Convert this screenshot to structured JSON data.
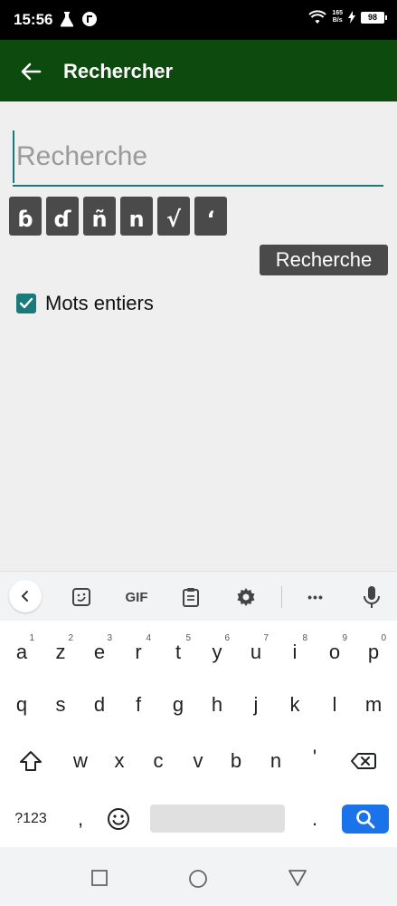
{
  "status": {
    "time": "15:56",
    "net_speed_value": "165",
    "net_speed_unit": "B/s",
    "battery": "98"
  },
  "app_bar": {
    "title": "Rechercher"
  },
  "search": {
    "placeholder": "Recherche",
    "value": ""
  },
  "special_chars": [
    "ɓ",
    "ɗ",
    "ñ",
    "n",
    "√",
    "ʻ"
  ],
  "search_button_label": "Recherche",
  "whole_words": {
    "label": "Mots entiers",
    "checked": true
  },
  "keyboard_toolbar": {
    "gif_label": "GIF",
    "more_label": "•••"
  },
  "keyboard": {
    "row1": [
      {
        "key": "a",
        "hint": "1"
      },
      {
        "key": "z",
        "hint": "2"
      },
      {
        "key": "e",
        "hint": "3"
      },
      {
        "key": "r",
        "hint": "4"
      },
      {
        "key": "t",
        "hint": "5"
      },
      {
        "key": "y",
        "hint": "6"
      },
      {
        "key": "u",
        "hint": "7"
      },
      {
        "key": "i",
        "hint": "8"
      },
      {
        "key": "o",
        "hint": "9"
      },
      {
        "key": "p",
        "hint": "0"
      }
    ],
    "row2": [
      "q",
      "s",
      "d",
      "f",
      "g",
      "h",
      "j",
      "k",
      "l",
      "m"
    ],
    "row3": [
      "w",
      "x",
      "c",
      "v",
      "b",
      "n",
      "'"
    ],
    "symbols_label": "?123",
    "comma": ",",
    "period": "."
  },
  "colors": {
    "app_bar": "#0d4a0d",
    "accent": "#1a7a7a",
    "char_button": "#4a4a4a",
    "enter_key": "#1a73e8"
  }
}
